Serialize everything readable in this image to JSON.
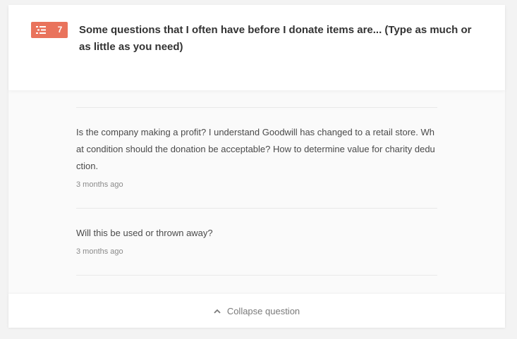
{
  "question": {
    "badge_count": "7",
    "badge_icon": "list-icon",
    "badge_color": "#e9735c",
    "title": "Some questions that I often have before I donate items are... (Type as much or as little as you need)"
  },
  "answers": [
    {
      "text": "Is the company making a profit? I understand Goodwill has changed to a retail store. What condition should the donation be acceptable? How to determine value for charity deduction.",
      "time": "3 months ago"
    },
    {
      "text": "Will this be used or thrown away?",
      "time": "3 months ago"
    }
  ],
  "footer": {
    "collapse_label": "Collapse question",
    "collapse_icon": "chevron-up-icon"
  }
}
